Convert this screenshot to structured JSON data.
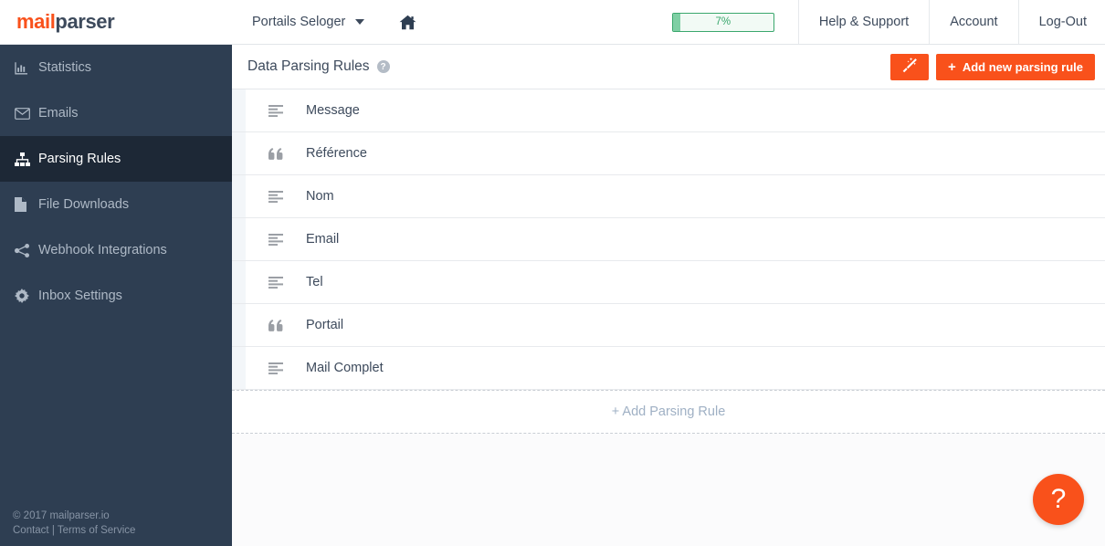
{
  "brand": {
    "part_orange": "mail",
    "part_dark": "parser"
  },
  "topbar": {
    "account_selector": "Portails Seloger",
    "home_icon": "home-icon",
    "caret_icon": "chevron-down-icon",
    "quota": {
      "label": "7%",
      "percent": 7,
      "border_color": "#3aa76d",
      "fill_color": "#7fcfa4"
    },
    "links": [
      {
        "label": "Help & Support"
      },
      {
        "label": "Account"
      },
      {
        "label": "Log-Out"
      }
    ]
  },
  "sidebar": {
    "items": [
      {
        "label": "Statistics",
        "icon": "bar-chart-icon",
        "active": false
      },
      {
        "label": "Emails",
        "icon": "envelope-icon",
        "active": false
      },
      {
        "label": "Parsing Rules",
        "icon": "sitemap-icon",
        "active": true
      },
      {
        "label": "File Downloads",
        "icon": "file-icon",
        "active": false
      },
      {
        "label": "Webhook Integrations",
        "icon": "share-nodes-icon",
        "active": false
      },
      {
        "label": "Inbox Settings",
        "icon": "gear-icon",
        "active": false
      }
    ],
    "footer": {
      "copyright": "© 2017 mailparser.io",
      "contact": "Contact",
      "separator": " | ",
      "terms": "Terms of Service"
    }
  },
  "page": {
    "title": "Data Parsing Rules",
    "help_icon": "question-circle-icon",
    "wand_button": {
      "icon": "magic-wand-icon",
      "label": ""
    },
    "add_button": {
      "plus": "+",
      "label": "Add new parsing rule"
    },
    "accent_color": "#f9511b"
  },
  "rules": [
    {
      "name": "Message",
      "icon": "align-left-icon"
    },
    {
      "name": "Référence",
      "icon": "quote-left-icon"
    },
    {
      "name": "Nom",
      "icon": "align-left-icon"
    },
    {
      "name": "Email",
      "icon": "align-left-icon"
    },
    {
      "name": "Tel",
      "icon": "align-left-icon"
    },
    {
      "name": "Portail",
      "icon": "quote-left-icon"
    },
    {
      "name": "Mail Complet",
      "icon": "align-left-icon"
    }
  ],
  "add_rule_row": {
    "label": "+ Add Parsing Rule"
  },
  "fab": {
    "glyph": "?",
    "name": "help-fab"
  }
}
